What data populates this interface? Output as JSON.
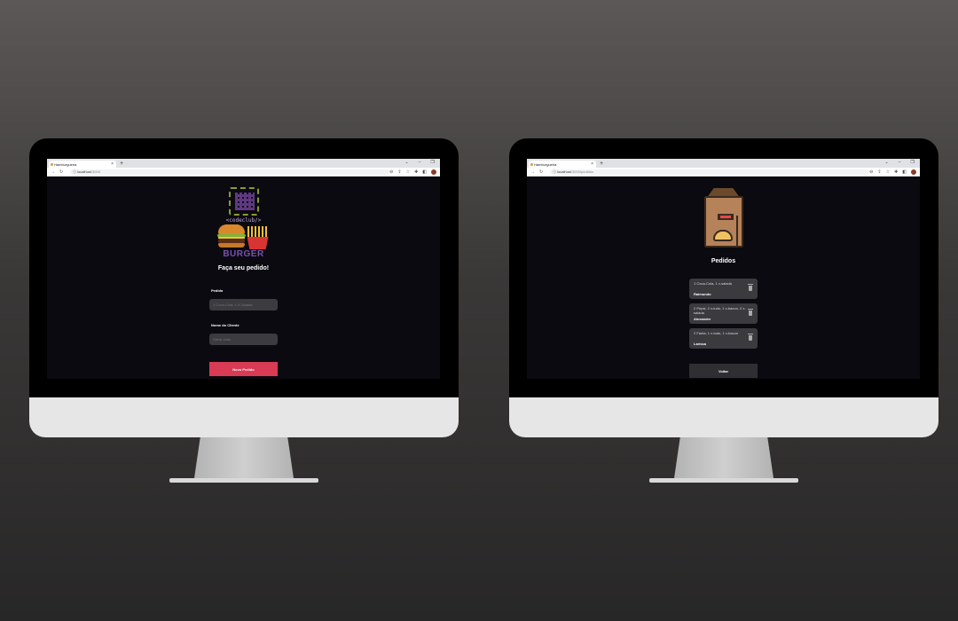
{
  "left": {
    "tab_title": "Hamburgueria",
    "tab_close": "×",
    "newtab": "+",
    "url_host": "localhost",
    "url_path": ":3000",
    "logo_text": "<codeclub/>",
    "logo_burger": "BURGER",
    "heading": "Faça seu pedido!",
    "order_label": "Pedido",
    "order_placeholder": "1 Coca-Cola, 1-X-Salada",
    "name_label": "Nome do Cliente",
    "name_placeholder": "Steve Jobs",
    "submit": "Novo Pedido"
  },
  "right": {
    "tab_title": "Hamburgueria",
    "tab_close": "×",
    "newtab": "+",
    "url_host": "localhost",
    "url_path": ":3000/pedidos",
    "heading": "Pedidos",
    "orders": [
      {
        "text": "1 Coca-Cola, 1 x-salada",
        "name": "Raimundo"
      },
      {
        "text": "2 Pepsi, 2 x-tudo, 1 x-bacon, 2 x-salada",
        "name": "Alexandre"
      },
      {
        "text": "2 Fanta, 1 x-tudo, 1 x-bacon",
        "name": "Larissa"
      }
    ],
    "back": "Voltar"
  }
}
